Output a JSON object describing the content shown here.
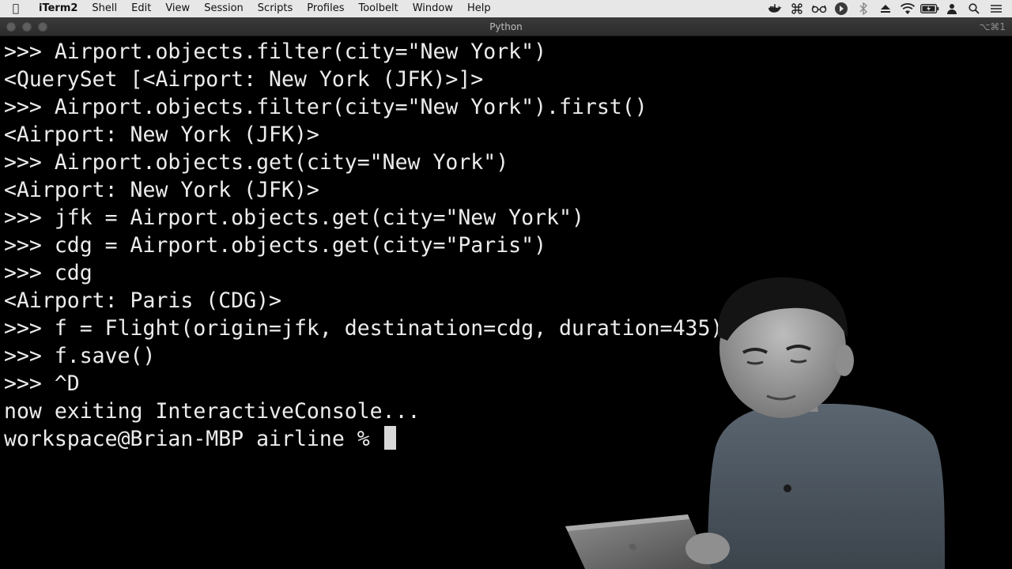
{
  "menubar": {
    "apple_glyph": "",
    "app_name": "iTerm2",
    "items": [
      "Shell",
      "Edit",
      "View",
      "Session",
      "Scripts",
      "Profiles",
      "Toolbelt",
      "Window",
      "Help"
    ],
    "status_icons": [
      "docker-icon",
      "command-icon",
      "glasses-icon",
      "media-icon",
      "bluetooth-icon",
      "eject-icon",
      "wifi-icon",
      "battery-icon",
      "user-icon",
      "search-icon",
      "control-center-icon"
    ]
  },
  "window": {
    "title": "Python",
    "shortcut": "⌥⌘1"
  },
  "terminal": {
    "lines": [
      ">>> Airport.objects.filter(city=\"New York\")",
      "<QuerySet [<Airport: New York (JFK)>]>",
      ">>> Airport.objects.filter(city=\"New York\").first()",
      "<Airport: New York (JFK)>",
      ">>> Airport.objects.get(city=\"New York\")",
      "<Airport: New York (JFK)>",
      ">>> jfk = Airport.objects.get(city=\"New York\")",
      ">>> cdg = Airport.objects.get(city=\"Paris\")",
      ">>> cdg",
      "<Airport: Paris (CDG)>",
      ">>> f = Flight(origin=jfk, destination=cdg, duration=435)",
      ">>> f.save()",
      ">>> ^D",
      "now exiting InteractiveConsole...",
      "workspace@Brian-MBP airline % "
    ]
  },
  "colors": {
    "menubar_bg": "#e7e7e7",
    "titlebar_bg": "#333333",
    "terminal_bg": "#000000",
    "terminal_fg": "#ececec",
    "cursor": "#d8d8d8"
  }
}
